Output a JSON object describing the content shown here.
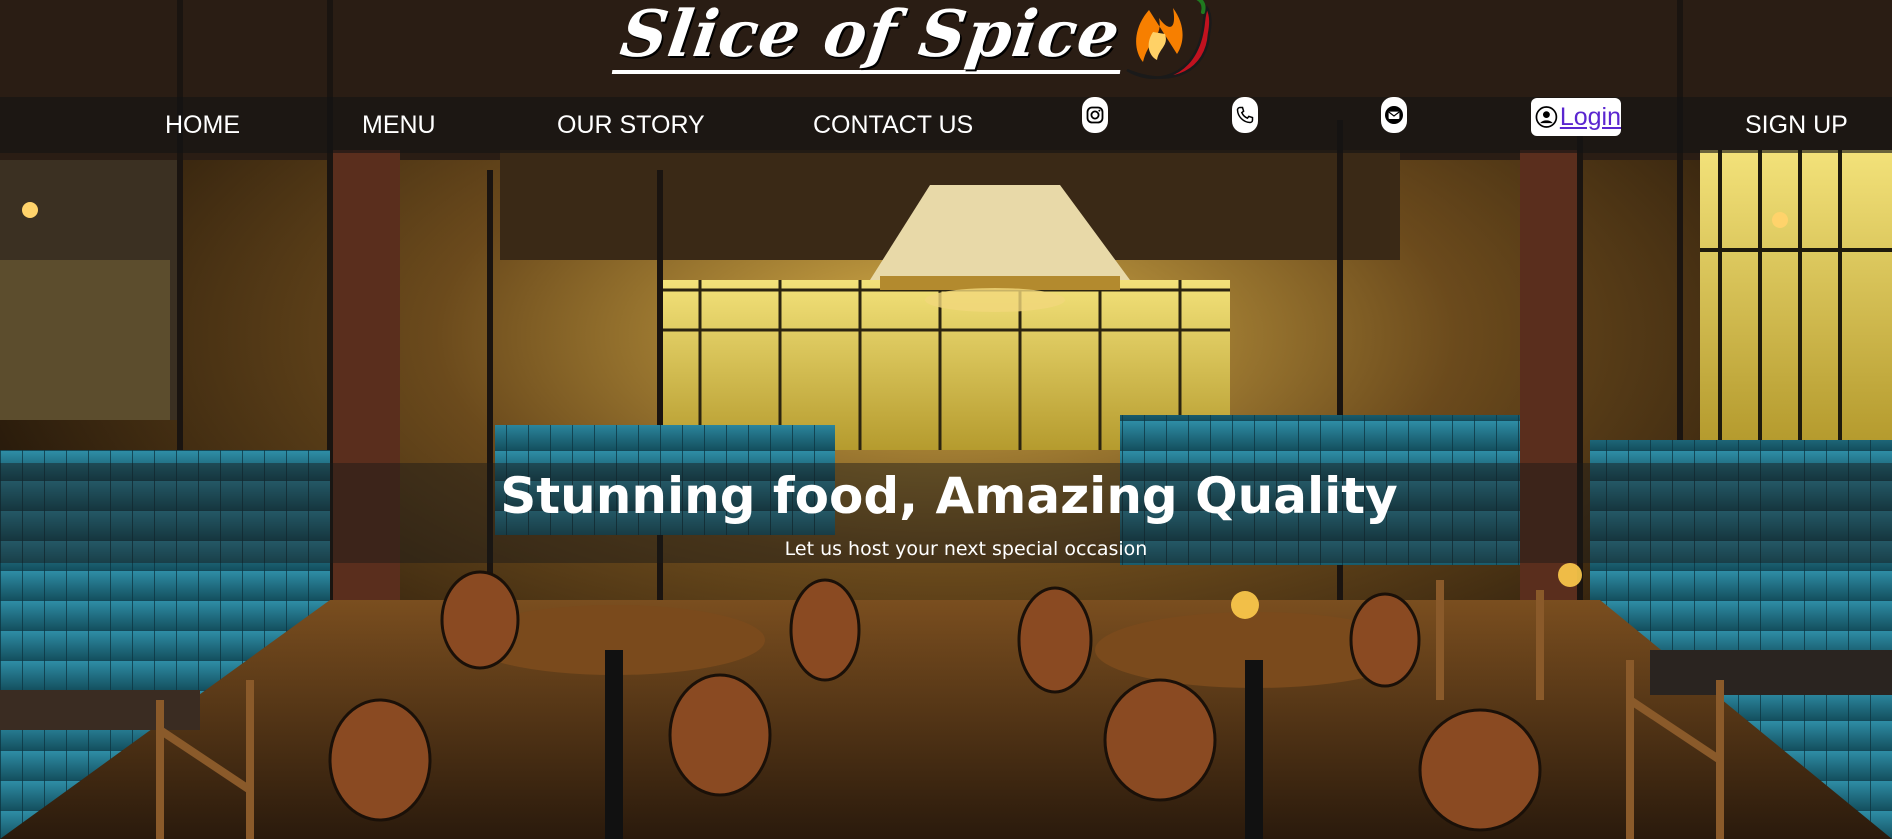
{
  "brand": {
    "logo_text": "Slice of Spice"
  },
  "nav": {
    "home": "HOME",
    "menu": "MENU",
    "our_story": "OUR STORY",
    "contact_us": "CONTACT US",
    "login": "Login",
    "sign_up": "SIGN UP",
    "icons": [
      "instagram-icon",
      "phone-icon",
      "mail-icon",
      "user-icon"
    ]
  },
  "hero": {
    "title": "Stunning food, Amazing Quality",
    "subtitle": "Let us host your next special occasion"
  },
  "colors": {
    "login_link": "#5a26d0",
    "chili": "#c1121f",
    "flame": "#f77f00"
  }
}
